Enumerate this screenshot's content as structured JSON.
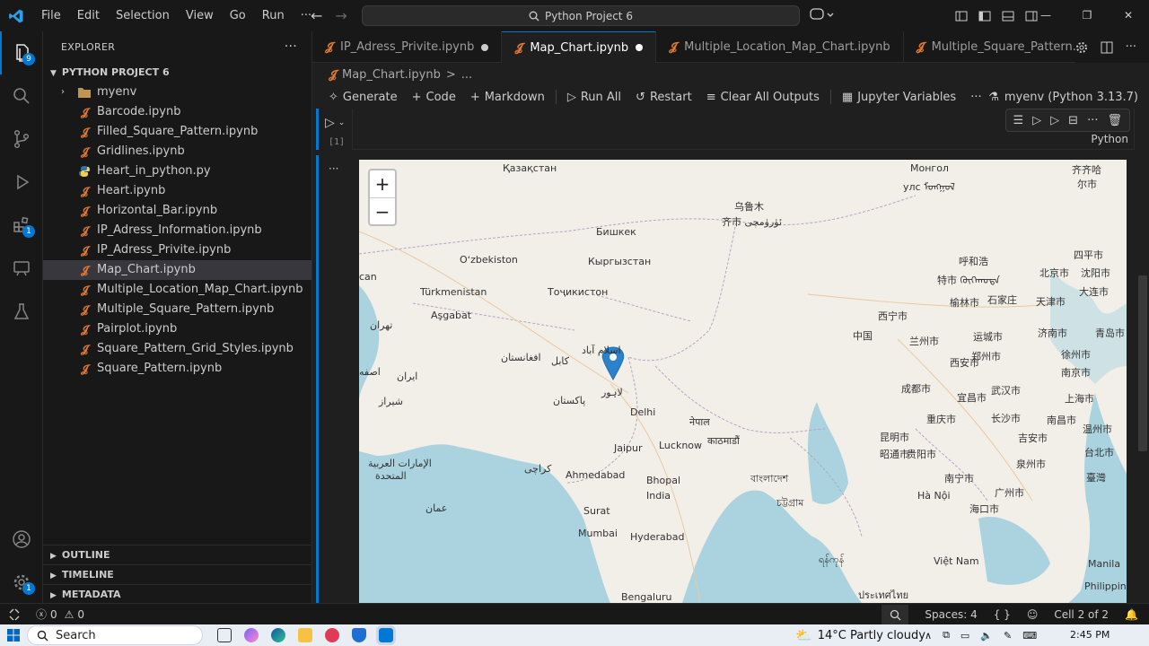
{
  "titlebar": {
    "menu": [
      "File",
      "Edit",
      "Selection",
      "View",
      "Go",
      "Run"
    ],
    "more": "···",
    "search": "Python Project 6"
  },
  "activity": {
    "explorer_badge": "9",
    "extensions_badge": "1",
    "settings_badge": "1"
  },
  "sidebar": {
    "title": "EXPLORER",
    "more": "···",
    "project": "PYTHON PROJECT 6",
    "items": [
      {
        "label": "myenv",
        "type": "folder"
      },
      {
        "label": "Barcode.ipynb",
        "type": "nb"
      },
      {
        "label": "Filled_Square_Pattern.ipynb",
        "type": "nb"
      },
      {
        "label": "Gridlines.ipynb",
        "type": "nb"
      },
      {
        "label": "Heart_in_python.py",
        "type": "py"
      },
      {
        "label": "Heart.ipynb",
        "type": "nb"
      },
      {
        "label": "Horizontal_Bar.ipynb",
        "type": "nb"
      },
      {
        "label": "IP_Adress_Information.ipynb",
        "type": "nb"
      },
      {
        "label": "IP_Adress_Privite.ipynb",
        "type": "nb"
      },
      {
        "label": "Map_Chart.ipynb",
        "type": "nb"
      },
      {
        "label": "Multiple_Location_Map_Chart.ipynb",
        "type": "nb"
      },
      {
        "label": "Multiple_Square_Pattern.ipynb",
        "type": "nb"
      },
      {
        "label": "Pairplot.ipynb",
        "type": "nb"
      },
      {
        "label": "Square_Pattern_Grid_Styles.ipynb",
        "type": "nb"
      },
      {
        "label": "Square_Pattern.ipynb",
        "type": "nb"
      }
    ],
    "sections": [
      "OUTLINE",
      "TIMELINE",
      "METADATA"
    ]
  },
  "tabs": [
    {
      "label": "IP_Adress_Privite.ipynb",
      "active": false
    },
    {
      "label": "Map_Chart.ipynb",
      "active": true
    },
    {
      "label": "Multiple_Location_Map_Chart.ipynb",
      "active": false
    },
    {
      "label": "Multiple_Square_Pattern.ipynb",
      "active": false
    }
  ],
  "breadcrumb": {
    "file": "Map_Chart.ipynb",
    "sep": ">",
    "rest": "..."
  },
  "toolbar": {
    "generate": "Generate",
    "code": "Code",
    "markdown": "Markdown",
    "run_all": "Run All",
    "restart": "Restart",
    "clear": "Clear All Outputs",
    "variables": "Jupyter Variables",
    "more": "···",
    "kernel": "myenv (Python 3.13.7)"
  },
  "cell": {
    "exec_count": "[1]",
    "language": "Python",
    "output_more": "···"
  },
  "map": {
    "zoom_in": "+",
    "zoom_out": "−",
    "labels": [
      "Қазақстан",
      "Монгол",
      "улс ᠮᠣᠩᠭᠣᠯ",
      "齐齐哈",
      "尔市",
      "乌鲁木",
      "齐市 ئۈرۈمچی",
      "Бишкек",
      "Oʻzbekiston",
      "Кыргызстан",
      "四平市",
      "沈阳市",
      "呼和浩",
      "特市 ᠬᠥᠬᠡᠬᠣᠲᠠ",
      "北京市",
      "大连市",
      "can",
      "Türkmenistan",
      "Тоҷикистон",
      "榆林市",
      "石家庄",
      "天津市",
      "Aşgabat",
      "西宁市",
      "兰州市",
      "运城市",
      "济南市",
      "青岛市",
      "تهران",
      "中国",
      "اسلام آباد",
      "افغانستان",
      "کابل",
      "郑州市",
      "徐州市",
      "西安市",
      "南京市",
      "ایران",
      "اصفه",
      "لاہور",
      "成都市",
      "宜昌市",
      "武汉市",
      "上海市",
      "پاکستان",
      "شیراز",
      "Delhi",
      "नेपाल",
      "重庆市",
      "长沙市",
      "南昌市",
      "温州市",
      "काठमाडौं",
      "Jaipur",
      "Lucknow",
      "昆明市",
      "贵阳市",
      "昭通市",
      "吉安市",
      "台北市",
      "الإمارات العربية",
      "المتحدة",
      "کراچی",
      "Ahmedabad",
      "Bhopal",
      "বাংলাদেশ",
      "泉州市",
      "臺灣",
      "India",
      "南宁市",
      "广州市",
      "Hà Nội",
      "চট্টগ্রাম",
      "عمان",
      "Surat",
      "海口市",
      "Mumbai",
      "Hyderabad",
      "ရန်ကုန်",
      "Việt Nam",
      "Manila",
      "Philippine",
      "Bengaluru",
      "ประเทศไทย"
    ]
  },
  "statusbar": {
    "errors": "0",
    "warnings": "0",
    "spaces": "Spaces: 4",
    "braces": "{ }",
    "cell": "Cell 2 of 2"
  },
  "taskbar": {
    "search": "Search",
    "weather": "14°C  Partly cloudy",
    "time": "2:45 PM"
  },
  "colors": {
    "accent": "#0078d4",
    "notebook_icon": "#e37933",
    "water": "#aad3df",
    "land": "#f2efe9",
    "marker": "#2b82cb"
  }
}
